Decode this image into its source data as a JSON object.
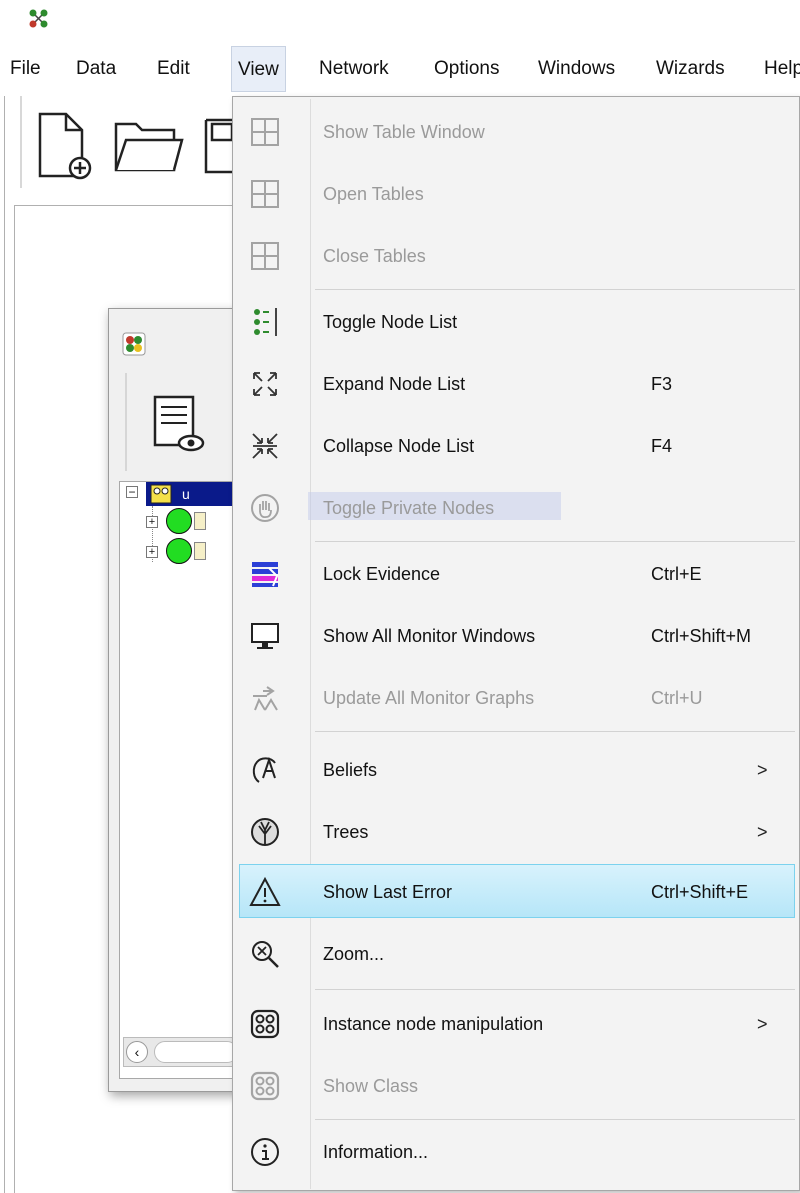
{
  "app": {
    "icon": "network-app-icon"
  },
  "menubar": {
    "items": [
      "File",
      "Data",
      "Edit",
      "View",
      "Network",
      "Options",
      "Windows",
      "Wizards",
      "Help"
    ],
    "active": "View"
  },
  "toolbar": {
    "icons": [
      "new-file-icon",
      "open-folder-icon",
      "save-icon"
    ]
  },
  "child_window": {
    "tree_nodes": [
      "u"
    ]
  },
  "view_menu": {
    "items": [
      {
        "label": "Show Table Window",
        "shortcut": "",
        "icon": "table-icon",
        "enabled": false,
        "submenu": false
      },
      {
        "label": "Open Tables",
        "shortcut": "",
        "icon": "table-icon",
        "enabled": false,
        "submenu": false
      },
      {
        "label": "Close Tables",
        "shortcut": "",
        "icon": "table-icon",
        "enabled": false,
        "submenu": false
      },
      {
        "label": "Toggle Node List",
        "shortcut": "",
        "icon": "node-list-icon",
        "enabled": true,
        "submenu": false
      },
      {
        "label": "Expand Node List",
        "shortcut": "F3",
        "icon": "expand-icon",
        "enabled": true,
        "submenu": false
      },
      {
        "label": "Collapse Node List",
        "shortcut": "F4",
        "icon": "collapse-icon",
        "enabled": true,
        "submenu": false
      },
      {
        "label": "Toggle Private Nodes",
        "shortcut": "",
        "icon": "hand-icon",
        "enabled": false,
        "submenu": false
      },
      {
        "label": "Lock Evidence",
        "shortcut": "Ctrl+E",
        "icon": "lock-evidence-icon",
        "enabled": true,
        "submenu": false
      },
      {
        "label": "Show All Monitor Windows",
        "shortcut": "Ctrl+Shift+M",
        "icon": "monitor-icon",
        "enabled": true,
        "submenu": false
      },
      {
        "label": "Update All Monitor Graphs",
        "shortcut": "Ctrl+U",
        "icon": "update-graph-icon",
        "enabled": false,
        "submenu": false
      },
      {
        "label": "Beliefs",
        "shortcut": "",
        "icon": "beliefs-icon",
        "enabled": true,
        "submenu": true
      },
      {
        "label": "Trees",
        "shortcut": "",
        "icon": "tree-icon",
        "enabled": true,
        "submenu": true
      },
      {
        "label": "Show Last Error",
        "shortcut": "Ctrl+Shift+E",
        "icon": "warning-icon",
        "enabled": true,
        "submenu": false,
        "highlighted": true
      },
      {
        "label": "Zoom...",
        "shortcut": "",
        "icon": "zoom-icon",
        "enabled": true,
        "submenu": false
      },
      {
        "label": "Instance node manipulation",
        "shortcut": "",
        "icon": "instance-node-icon",
        "enabled": true,
        "submenu": true
      },
      {
        "label": "Show Class",
        "shortcut": "",
        "icon": "instance-node-icon",
        "enabled": false,
        "submenu": false
      },
      {
        "label": "Information...",
        "shortcut": "",
        "icon": "info-icon",
        "enabled": true,
        "submenu": false
      }
    ],
    "submenu_arrow": ">"
  },
  "colors": {
    "highlight": "#b6e6f8",
    "highlight_border": "#7cd2ee",
    "disabled_text": "#9a9a9a",
    "menu_bg": "#f3f3f3"
  }
}
